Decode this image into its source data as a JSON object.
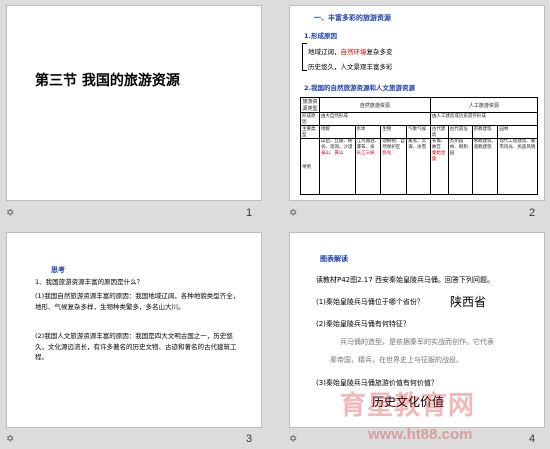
{
  "slides": [
    {
      "number": "1",
      "title": "第三节  我国的旅游资源"
    },
    {
      "number": "2",
      "heading": "一、丰富多彩的旅游资源",
      "sub1": "1.形成原因",
      "line1a": "地域辽阔，",
      "line1b": "自然环境",
      "line1c": "复杂多变",
      "line2": "历史悠久，人文景观丰富多彩",
      "sub2": "2.我国的自然旅游资源和人文旅游资源",
      "table": {
        "h1": "旅游资源类型",
        "h2": "自然旅游资源",
        "h3": "人工旅游资源",
        "r1": [
          "形成原因",
          "由大自然形成",
          "由人工建造或历史遗存形成"
        ],
        "r2": [
          "主要类型",
          "地貌",
          "水体",
          "生物",
          "气象气候",
          "古代建筑",
          "古代遗址",
          "宗教建筑",
          "园林"
        ],
        "c1": "山岳、丘陵、峡谷、溶洞、沙漠",
        "c1r": "泰山、黄山",
        "c2": "江河湖泊、瀑布、泉",
        "c2r": "长江三峡",
        "c3": "动植物、自然保护区",
        "c3r": "卧龙",
        "c4": "雾凇、云海、冰雪",
        "c5": "长城、故宫",
        "c5r": "秦始皇陵",
        "c6": "苏州园林、颐和园",
        "c7": "佛教建筑、道教建筑",
        "c8": "现代工程建筑、都市风光、民族风情",
        "lbl": "举例"
      }
    },
    {
      "number": "3",
      "title": "思考",
      "q": "1、我国旅游资源丰富的原因是什么？",
      "p1": "(1)我国自然旅游资源丰富的原因：我国地域辽阔，各种地貌类型齐全，地形、气候复杂多样，生物种类繁多，多名山大川。",
      "p2": "(2)我国人文旅游资源丰富的原因：我国是四大文明古国之一，历史悠久，文化源远流长，有许多著名的历史文物、古迹和著名的古代建筑工程。"
    },
    {
      "number": "4",
      "heading": "图表解读",
      "q0": "读教材P42图2.17  西安秦始皇陵兵马俑。回答下列问题。",
      "q1": "(1)秦始皇陵兵马俑位于哪个省份？",
      "a1": "陕西省",
      "q2": "(2)秦始皇陵兵马俑有何特征？",
      "l1": "兵马俑的造型，是依据秦军的实战而创作。它代表",
      "l2": "秦帝国，精兵，在世界史上与征服的战役。",
      "q3": "(3)秦始皇陵兵马俑旅游价值有何价值？",
      "a3": "历史文化价值"
    }
  ],
  "watermark": {
    "text": "育星教育网",
    "url": "www.ht88.com"
  }
}
